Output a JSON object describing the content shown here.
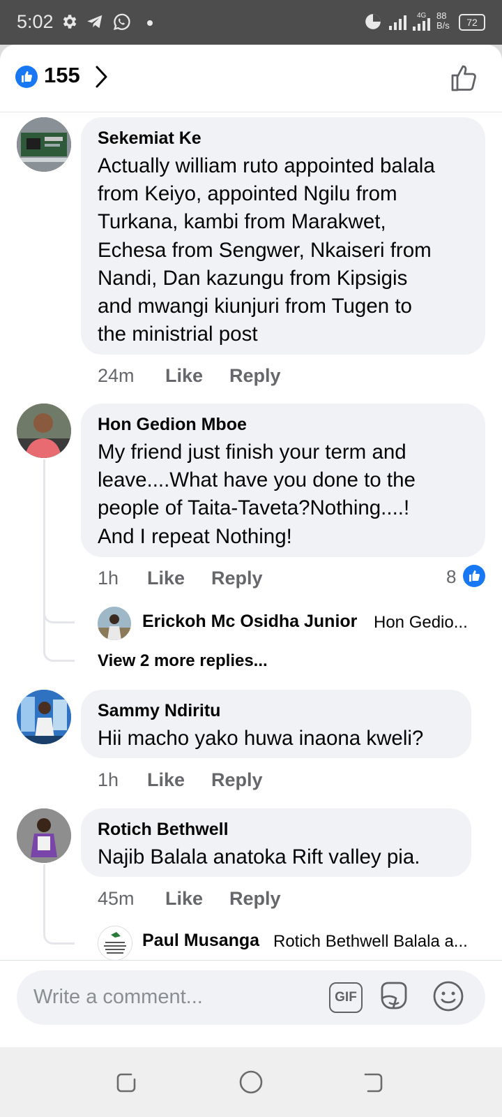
{
  "status_bar": {
    "time": "5:02",
    "icons": [
      "gear-icon",
      "telegram-icon",
      "whatsapp-icon",
      "dot-icon",
      "data-saver-icon",
      "signal-4g-icon",
      "signal-icon"
    ],
    "network_speed_value": "88",
    "network_speed_unit": "B/s",
    "battery": "72"
  },
  "header": {
    "like_count": "155"
  },
  "comments": [
    {
      "author": "Sekemiat Ke",
      "text": "Actually william ruto appointed balala\nfrom Keiyo,  appointed Ngilu from\nTurkana,  kambi from Marakwet,\nEchesa from Sengwer,  Nkaiseri from\nNandi,  Dan kazungu from Kipsigis\nand mwangi kiunjuri from Tugen to\nthe ministrial post",
      "time": "24m",
      "like": "Like",
      "reply": "Reply"
    },
    {
      "author": "Hon Gedion Mboe",
      "text": "My friend just finish your term and\nleave....What have you done to the\npeople of Taita-Taveta?Nothing....!\nAnd I repeat Nothing!",
      "time": "1h",
      "like": "Like",
      "reply": "Reply",
      "reaction_count": "8",
      "reply_preview": {
        "author": "Erickoh Mc Osidha Junior",
        "snippet": "Hon Gedio..."
      },
      "view_more": "View 2 more replies..."
    },
    {
      "author": "Sammy Ndiritu",
      "text": "Hii macho yako huwa inaona kweli?",
      "time": "1h",
      "like": "Like",
      "reply": "Reply"
    },
    {
      "author": "Rotich Bethwell",
      "text": "Najib Balala anatoka Rift valley pia.",
      "time": "45m",
      "like": "Like",
      "reply": "Reply",
      "reply_preview": {
        "author": "Paul Musanga",
        "snippet": "Rotich Bethwell Balala a..."
      }
    }
  ],
  "composer": {
    "placeholder": "Write a comment...",
    "gif_label": "GIF"
  },
  "colors": {
    "accent": "#1877f2",
    "bubble": "#f0f2f5",
    "meta_text": "#65676b",
    "status_bar": "#4d4d4d"
  }
}
